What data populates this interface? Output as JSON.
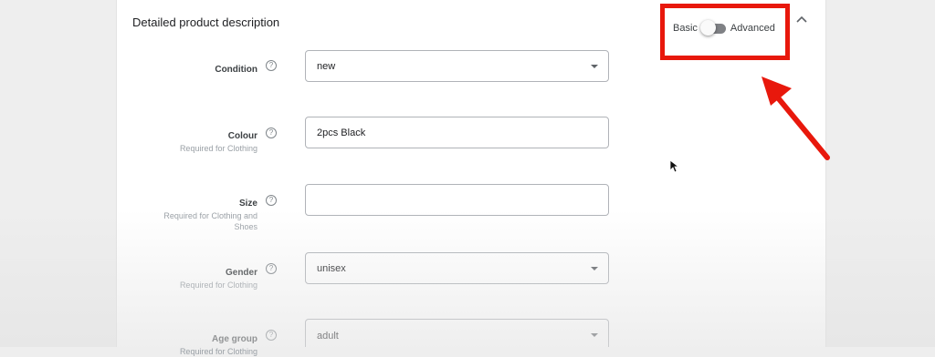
{
  "section": {
    "title": "Detailed product description"
  },
  "mode_toggle": {
    "basic_label": "Basic",
    "advanced_label": "Advanced",
    "state": "basic"
  },
  "fields": {
    "condition": {
      "label": "Condition",
      "value": "new"
    },
    "colour": {
      "label": "Colour",
      "hint": "Required for Clothing",
      "value": "2pcs Black"
    },
    "size": {
      "label": "Size",
      "hint_line1": "Required for Clothing and",
      "hint_line2": "Shoes",
      "value": ""
    },
    "gender": {
      "label": "Gender",
      "hint": "Required for Clothing",
      "value": "unisex"
    },
    "age_group": {
      "label": "Age group",
      "hint": "Required for Clothing",
      "value": "adult"
    }
  },
  "icons": {
    "help": "help-circle-icon",
    "collapse": "chevron-up-icon",
    "dropdown": "caret-down-icon",
    "cursor": "mouse-pointer-icon"
  },
  "help_glyph": "?",
  "colors": {
    "annotation": "#e8180c",
    "toggle_track": "#7f8185",
    "field_border": "#b0b3b8"
  }
}
